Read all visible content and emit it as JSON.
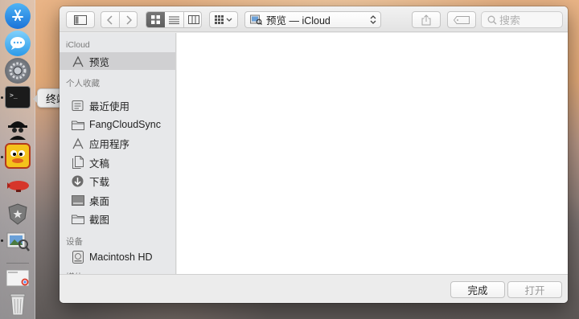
{
  "dock": {
    "tooltip": "终端",
    "apps": [
      {
        "name": "app-store-icon"
      },
      {
        "name": "messages-icon"
      },
      {
        "name": "system-preferences-icon"
      },
      {
        "name": "terminal-icon"
      },
      {
        "name": "spy-app-icon"
      },
      {
        "name": "cyberduck-icon"
      },
      {
        "name": "blimp-app-icon"
      },
      {
        "name": "shield-app-icon"
      },
      {
        "name": "preview-icon"
      },
      {
        "name": "chrome-screenshot-icon"
      },
      {
        "name": "trash-icon"
      }
    ]
  },
  "toolbar": {
    "location_label": "预览 — iCloud",
    "search_placeholder": "搜索"
  },
  "sidebar": {
    "sections": [
      {
        "heading": "iCloud",
        "items": [
          {
            "label": "预览",
            "icon": "preview-app-icon",
            "selected": true
          }
        ]
      },
      {
        "heading": "个人收藏",
        "items": [
          {
            "label": "最近使用",
            "icon": "recents-icon"
          },
          {
            "label": "FangCloudSync",
            "icon": "folder-icon"
          },
          {
            "label": "应用程序",
            "icon": "applications-icon"
          },
          {
            "label": "文稿",
            "icon": "documents-icon"
          },
          {
            "label": "下载",
            "icon": "downloads-icon"
          },
          {
            "label": "桌面",
            "icon": "desktop-icon"
          },
          {
            "label": "截图",
            "icon": "folder-icon"
          }
        ]
      },
      {
        "heading": "设备",
        "items": [
          {
            "label": "Macintosh HD",
            "icon": "hard-drive-icon"
          }
        ]
      },
      {
        "heading": "媒体",
        "items": []
      }
    ]
  },
  "footer": {
    "done_label": "完成",
    "open_label": "打开"
  },
  "colors": {
    "selected_row": "#d0d0d2",
    "active_view_button": "#676767"
  }
}
